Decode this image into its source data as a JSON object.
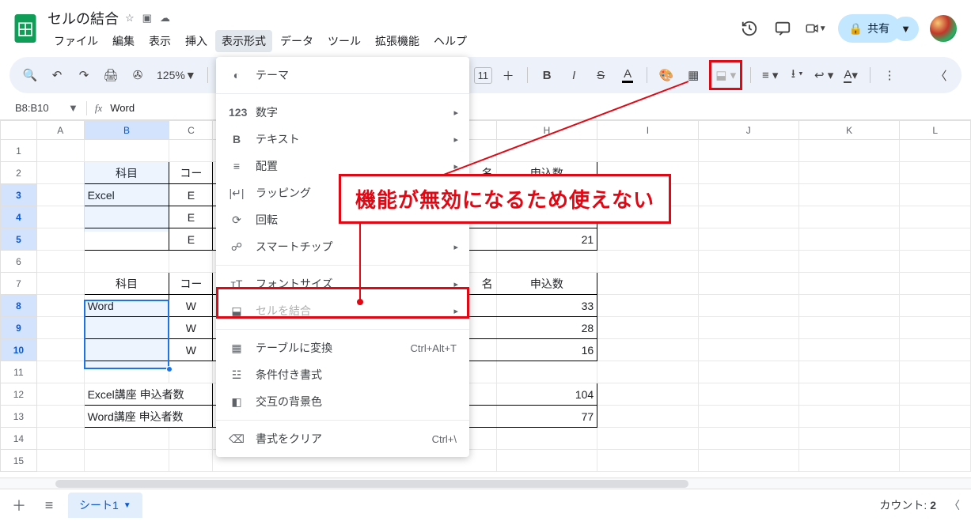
{
  "doc": {
    "title": "セルの結合"
  },
  "menu": {
    "file": "ファイル",
    "edit": "編集",
    "view": "表示",
    "insert": "挿入",
    "format": "表示形式",
    "data": "データ",
    "tools": "ツール",
    "extensions": "拡張機能",
    "help": "ヘルプ"
  },
  "toolbar": {
    "zoom": "125%"
  },
  "share": {
    "label": "共有"
  },
  "namebox": "B8:B10",
  "fx_value": "Word",
  "columns": [
    "A",
    "B",
    "C",
    "H",
    "I",
    "J",
    "K",
    "L"
  ],
  "dropdown": {
    "theme": "テーマ",
    "number": "数字",
    "text": "テキスト",
    "align": "配置",
    "wrap": "ラッピング",
    "rotate": "回転",
    "smartchip": "スマートチップ",
    "fontsize": "フォントサイズ",
    "merge": "セルを結合",
    "table": "テーブルに変換",
    "table_shortcut": "Ctrl+Alt+T",
    "condfmt": "条件付き書式",
    "altcolor": "交互の背景色",
    "clear": "書式をクリア",
    "clear_shortcut": "Ctrl+\\"
  },
  "annot": "機能が無効になるため使えない",
  "grid": {
    "r2": {
      "b": "科目",
      "c": "コー",
      "g_tail": "名",
      "h": "申込数"
    },
    "r3": {
      "b": "Excel",
      "c": "E"
    },
    "r4": {
      "c": "E"
    },
    "r5": {
      "c": "E",
      "h": "21"
    },
    "r7": {
      "b": "科目",
      "c": "コー",
      "g_tail": "名",
      "h": "申込数"
    },
    "r8": {
      "b": "Word",
      "c": "W",
      "h": "33"
    },
    "r9": {
      "c": "W",
      "h": "28"
    },
    "r10": {
      "c": "W",
      "h": "16"
    },
    "r12": {
      "b": "Excel講座 申込者数",
      "h": "104"
    },
    "r13": {
      "b": "Word講座 申込者数",
      "h": "77"
    }
  },
  "tabs": {
    "sheet1": "シート1"
  },
  "status": {
    "count_label": "カウント:",
    "count_value": "2"
  }
}
